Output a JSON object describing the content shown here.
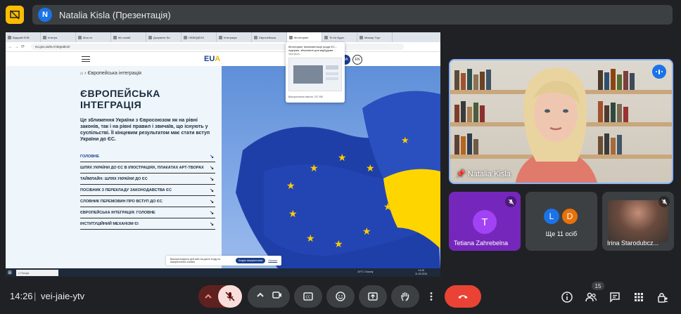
{
  "presenter": {
    "initial": "N",
    "title": "Natalia Kisla (Презентація)"
  },
  "browser": {
    "tabs": [
      "Відкрий ЕНВ",
      "Інтегра",
      "Моя сп",
      "Мо ознай",
      "Документ Бе",
      "НЕВЕДЕНО",
      "Інтеграція",
      "Європейська",
      "Моніторинг",
      "Те Ка будет",
      "Міжнар Торг"
    ],
    "url": "eu.gov.ua/eu-integration/",
    "popup_title": "Моніторинг імплементації угоди ЄС...",
    "popup_subtitle": "лідерам, збережені для відбудови ...",
    "popup_url": "Інтегра.eu",
    "popup_memory": "Використання пам'яті: 227 МБ"
  },
  "site": {
    "logo_main": "EU",
    "logo_accent": "A",
    "lang_ua": "UA",
    "lang_en": "EN",
    "breadcrumb": "Європейська інтеграція",
    "title": "ЄВРОПЕЙСЬКА ІНТЕГРАЦІЯ",
    "intro": "Це зближення України з Євросоюзом як на рівні законів, так і на рівні правил і звичаїв, що існують у суспільстві. Її кінцевим результатом має стати вступ України до ЄС.",
    "menu": [
      {
        "label": "ГОЛОВНЕ"
      },
      {
        "label": "ШЛЯХ УКРАЇНИ ДО ЄС В ІЛЮСТРАЦІЯХ, ПЛАКАТАХ АРТ-ТВОРАХ"
      },
      {
        "label": "ТАЙМЛАЙН: ШЛЯХ УКРАЇНИ ДО ЄС"
      },
      {
        "label": "ПОСІБНИК З ПЕРЕКЛАДУ ЗАКОНОДАВСТВА ЄС"
      },
      {
        "label": "СЛОВНИК ПЕРЕМОВИН ПРО ВСТУП ДО ЄС"
      },
      {
        "label": "ЄВРОПЕЙСЬКА ІНТЕГРАЦІЯ: ГОЛОВНЕ"
      },
      {
        "label": "ІНСТИТУЦІЙНИЙ МЕХАНІЗМ ЄІ"
      }
    ],
    "cookie_text": "Використовуючи цей сайт ви даєте згоду на використання cookies",
    "cookie_accept": "Згоден використання",
    "cookie_settings": "Налашт"
  },
  "taskbar": {
    "search": "Пошук",
    "weather": "10°C  Cloudy",
    "time": "14:26",
    "date": "11.03.2024"
  },
  "participants": {
    "main_name": "Natalia Kisla",
    "tetiana_initial": "T",
    "tetiana_name": "Tetiana Zahrebelna",
    "more_initial_1": "L",
    "more_initial_2": "D",
    "more_label": "Ще 11 осіб",
    "irina_name": "Irina Starodubcz..."
  },
  "meeting": {
    "time": "14:26",
    "separator": "|",
    "code": "vei-jaie-ytv",
    "participant_count": "15"
  },
  "colors": {
    "accent": "#8ab4f8",
    "leave": "#ea4335",
    "tile_purple": "#7627bb",
    "eu_blue": "#003399",
    "eu_star": "#ffcc00",
    "ua_yellow": "#ffd500"
  }
}
